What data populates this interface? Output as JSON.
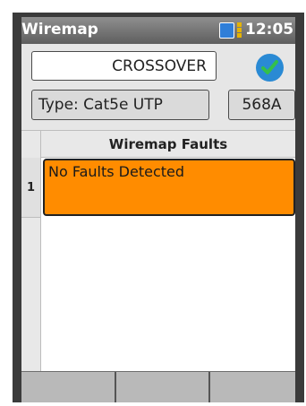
{
  "status_bar": {
    "title": "Wiremap",
    "time": "12:05",
    "battery_color": "#2f7ed8",
    "battery_charge_color": "#e5b300",
    "battery_icon": "battery-icon"
  },
  "test_result": {
    "mode": "CROSSOVER",
    "status_icon": "checkmark-icon",
    "status_color": "#2a8ad4"
  },
  "cable": {
    "type_label": "Type: Cat5e UTP",
    "standard": "568A"
  },
  "faults_table": {
    "header": "Wiremap Faults",
    "rows": [
      {
        "index": "1",
        "text": "No Faults Detected"
      }
    ],
    "highlight_color": "#ff8c00"
  },
  "softkeys": [
    {
      "label": ""
    },
    {
      "label": ""
    },
    {
      "label": ""
    }
  ]
}
